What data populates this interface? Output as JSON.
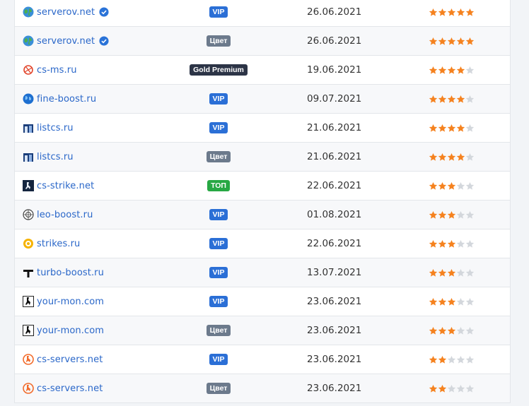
{
  "rows": [
    {
      "site": "serverov.net",
      "icon": "globe-icon",
      "verified": true,
      "badge": "VIP",
      "badge_color": "#2b6fd6",
      "date": "26.06.2021",
      "rating": 5
    },
    {
      "site": "serverov.net",
      "icon": "globe-icon",
      "verified": true,
      "badge": "Цвет",
      "badge_color": "#6c7a8c",
      "date": "26.06.2021",
      "rating": 5
    },
    {
      "site": "cs-ms.ru",
      "icon": "cs-ms-icon",
      "verified": false,
      "badge": "Gold Premium",
      "badge_color": "#2c3446",
      "date": "19.06.2021",
      "rating": 4
    },
    {
      "site": "fine-boost.ru",
      "icon": "globe-blue-icon",
      "verified": false,
      "badge": "VIP",
      "badge_color": "#2b6fd6",
      "date": "09.07.2021",
      "rating": 4
    },
    {
      "site": "listcs.ru",
      "icon": "listcs-icon",
      "verified": false,
      "badge": "VIP",
      "badge_color": "#2b6fd6",
      "date": "21.06.2021",
      "rating": 4
    },
    {
      "site": "listcs.ru",
      "icon": "listcs-icon",
      "verified": false,
      "badge": "Цвет",
      "badge_color": "#6c7a8c",
      "date": "21.06.2021",
      "rating": 4
    },
    {
      "site": "cs-strike.net",
      "icon": "cs-strike-icon",
      "verified": false,
      "badge": "ТОП",
      "badge_color": "#27a844",
      "date": "22.06.2021",
      "rating": 3
    },
    {
      "site": "leo-boost.ru",
      "icon": "leo-boost-icon",
      "verified": false,
      "badge": "VIP",
      "badge_color": "#2b6fd6",
      "date": "01.08.2021",
      "rating": 3
    },
    {
      "site": "strikes.ru",
      "icon": "strikes-icon",
      "verified": false,
      "badge": "VIP",
      "badge_color": "#2b6fd6",
      "date": "22.06.2021",
      "rating": 3
    },
    {
      "site": "turbo-boost.ru",
      "icon": "turbo-boost-icon",
      "verified": false,
      "badge": "VIP",
      "badge_color": "#2b6fd6",
      "date": "13.07.2021",
      "rating": 3
    },
    {
      "site": "your-mon.com",
      "icon": "your-mon-icon",
      "verified": false,
      "badge": "VIP",
      "badge_color": "#2b6fd6",
      "date": "23.06.2021",
      "rating": 3
    },
    {
      "site": "your-mon.com",
      "icon": "your-mon-icon",
      "verified": false,
      "badge": "Цвет",
      "badge_color": "#6c7a8c",
      "date": "23.06.2021",
      "rating": 3
    },
    {
      "site": "cs-servers.net",
      "icon": "cs-servers-icon",
      "verified": false,
      "badge": "VIP",
      "badge_color": "#2b6fd6",
      "date": "23.06.2021",
      "rating": 2
    },
    {
      "site": "cs-servers.net",
      "icon": "cs-servers-icon",
      "verified": false,
      "badge": "Цвет",
      "badge_color": "#6c7a8c",
      "date": "23.06.2021",
      "rating": 2
    }
  ],
  "rating_max": 5,
  "colors": {
    "link": "#2a67c9",
    "star_on": "#f5821f",
    "star_off": "#d3d7dc",
    "verified": "#2a73d8"
  }
}
